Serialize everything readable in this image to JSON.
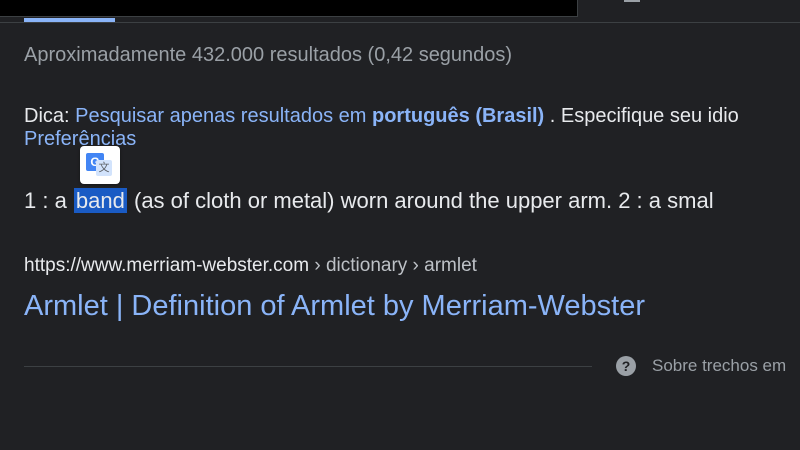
{
  "header": {
    "active_tab_color": "#8ab4f8"
  },
  "results": {
    "stats": "Aproximadamente 432.000 resultados (0,42 segundos)",
    "tip": {
      "label": "Dica:",
      "link_text": "Pesquisar apenas resultados em",
      "link_bold": "português (Brasil)",
      "after_text": ". Especifique seu idio",
      "preferences_link": "Preferências"
    },
    "translate_button_icon": "google-translate-icon",
    "snippet": {
      "prefix": "1 : a ",
      "highlighted": "band",
      "suffix": " (as of cloth or metal) worn around the upper arm. 2 : a smal"
    },
    "item": {
      "url": "https://www.merriam-webster.com",
      "breadcrumbs": " › dictionary › armlet",
      "title": "Armlet | Definition of Armlet by Merriam-Webster"
    },
    "about_snippets": "Sobre trechos em",
    "help_icon": "help-circle-icon"
  }
}
